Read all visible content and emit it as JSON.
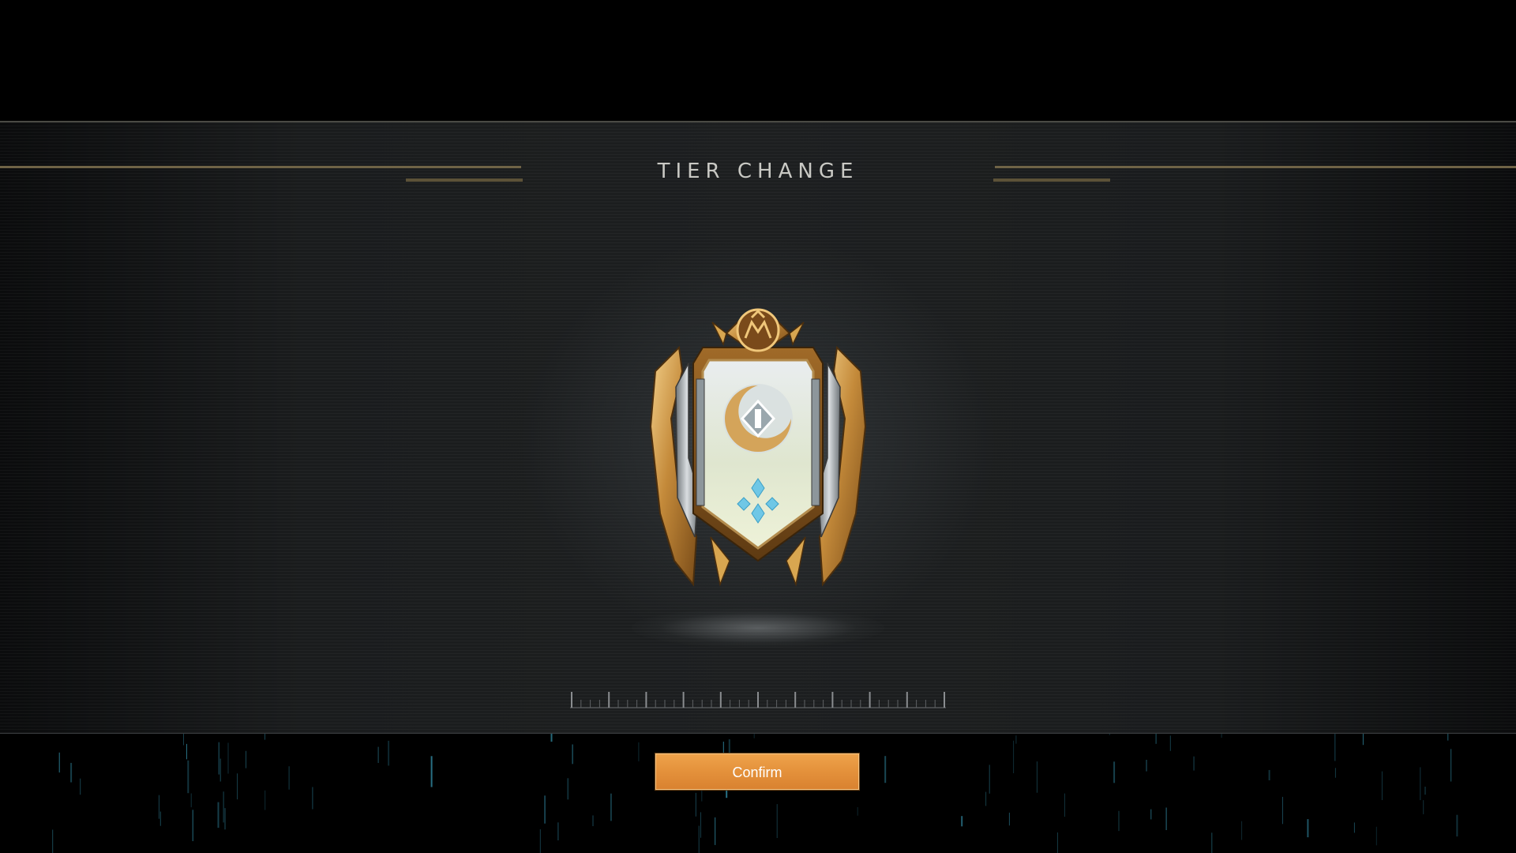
{
  "screen": {
    "title": "TIER CHANGE"
  },
  "badge": {
    "icon": "rank-badge-icon",
    "emblem": "crescent-emblem-icon",
    "tier_mark": "diamond-cluster-icon",
    "crest": "am-crest-icon"
  },
  "actions": {
    "confirm_label": "Confirm"
  },
  "colors": {
    "accent_gold": "#c79a4a",
    "confirm_orange": "#e4913b",
    "rain_blue": "#2e7f96",
    "title_text": "#c9c9c4"
  }
}
